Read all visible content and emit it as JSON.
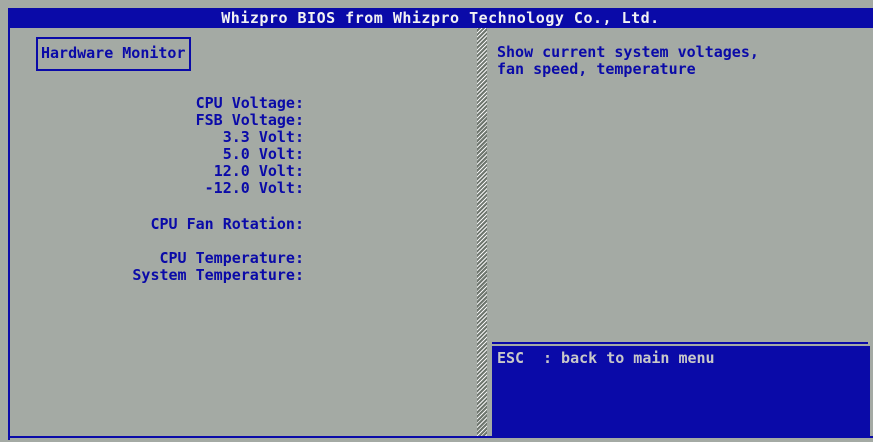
{
  "header": {
    "title": "Whizpro BIOS from Whizpro Technology Co., Ltd."
  },
  "panel": {
    "heading": "Hardware Monitor",
    "fields": [
      {
        "label": "CPU Voltage:"
      },
      {
        "label": "FSB Voltage:"
      },
      {
        "label": "3.3 Volt:"
      },
      {
        "label": "5.0 Volt:"
      },
      {
        "label": "12.0 Volt:"
      },
      {
        "label": "-12.0 Volt:"
      },
      {
        "label": "CPU Fan Rotation:"
      },
      {
        "label": "CPU Temperature:"
      },
      {
        "label": "System Temperature:"
      }
    ]
  },
  "help": {
    "lines": [
      "Show current system voltages,",
      "fan speed, temperature"
    ]
  },
  "keys": [
    {
      "key": "ESC",
      "description": ": back to main menu"
    }
  ],
  "colors": {
    "background": "#a4aaa4",
    "accent": "#0a0aa8",
    "title_text": "#f2f2f2",
    "key_text": "#c8c8c8"
  }
}
